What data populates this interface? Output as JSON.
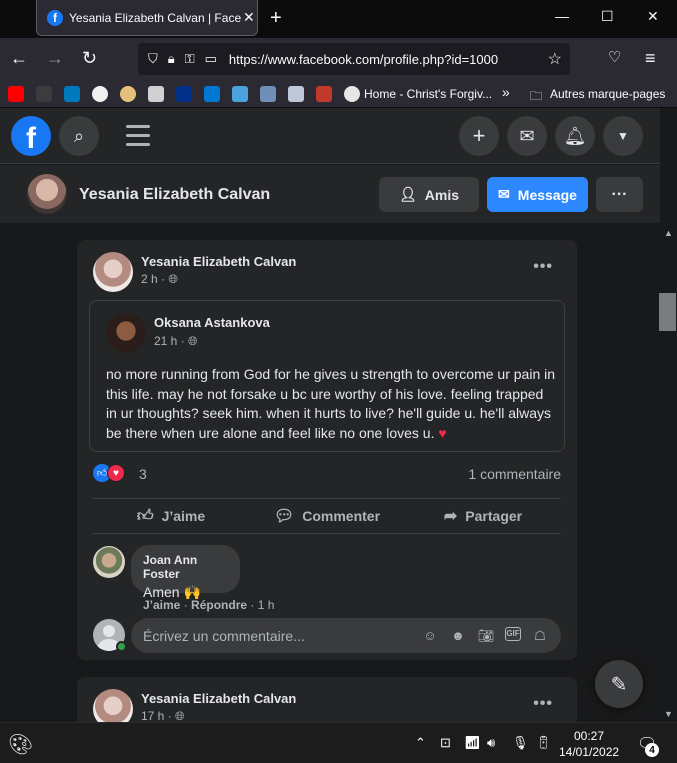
{
  "browser": {
    "tab_title": "Yesania Elizabeth Calvan | Facebook",
    "tab_icon": "f",
    "url": "https://www.facebook.com/profile.php?id=1000",
    "bookmarks_folder": "Autres marque-pages",
    "bookmark_home": "Home - Christ's Forgiv..."
  },
  "profile": {
    "name": "Yesania Elizabeth Calvan",
    "friends_label": "Amis",
    "message_label": "Message",
    "more_label": "···"
  },
  "post1": {
    "author": "Yesania Elizabeth Calvan",
    "time": "2 h ·",
    "shared": {
      "author": "Oksana Astankova",
      "time": "21 h ·",
      "text": "no more running from God for he gives u strength to overcome ur pain in this life. may he not forsake u bc ure worthy of his love. feeling trapped in ur thoughts? seek him. when it hurts to live? he'll guide u. he'll always be there when ure alone and feel like no one loves u.",
      "emoji": "♥"
    },
    "reaction_count": "3",
    "comments_count": "1 commentaire",
    "actions": {
      "like": "J’aime",
      "comment": "Commenter",
      "share": "Partager"
    },
    "comment": {
      "author": "Joan Ann Foster",
      "text": "Amen 🙌",
      "like": "J’aime",
      "reply": "Répondre",
      "time": "1 h"
    },
    "write_placeholder": "Écrivez un commentaire..."
  },
  "post2": {
    "author": "Yesania Elizabeth Calvan",
    "time": "17 h ·"
  },
  "taskbar": {
    "time": "00:27",
    "date": "14/01/2022",
    "notifications": "4"
  },
  "colors": {
    "accent": "#2d88ff",
    "surface": "#242526",
    "background": "#18191a"
  }
}
